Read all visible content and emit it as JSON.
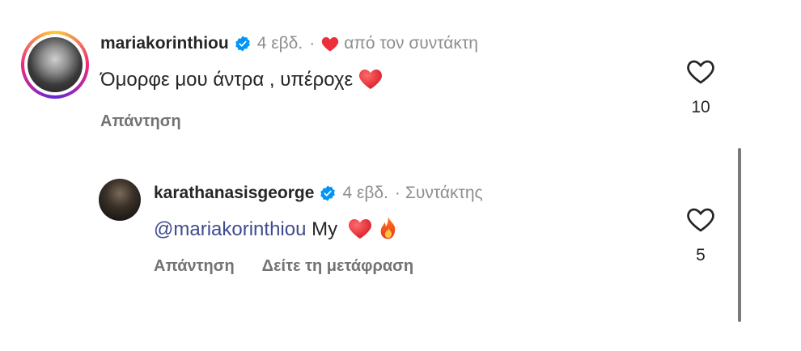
{
  "comments": [
    {
      "username": "mariakorinthiou",
      "verified": true,
      "age": "4 εβδ.",
      "separator": "·",
      "liked_by_author_label": "από τον συντάκτη",
      "text": "Όμορφε μου άντρα , υπέροχε",
      "emoji": "heart",
      "reply_label": "Απάντηση",
      "likes": "10"
    },
    {
      "username": "karathanasisgeorge",
      "verified": true,
      "age": "4 εβδ.",
      "separator": "·",
      "author_badge": "Συντάκτης",
      "mention": "@mariakorinthiou",
      "text": " My ",
      "emojis": [
        "heart",
        "fire"
      ],
      "reply_label": "Απάντηση",
      "translate_label": "Δείτε τη μετάφραση",
      "likes": "5"
    }
  ],
  "icons": {
    "verified": "verified-badge-icon",
    "like": "heart-outline-icon",
    "author_heart": "heart-filled-icon"
  },
  "colors": {
    "verified_blue": "#0095f6",
    "heart_red": "#ed2f3c",
    "mention": "#3f4b8f",
    "muted": "#8e8e8e"
  }
}
